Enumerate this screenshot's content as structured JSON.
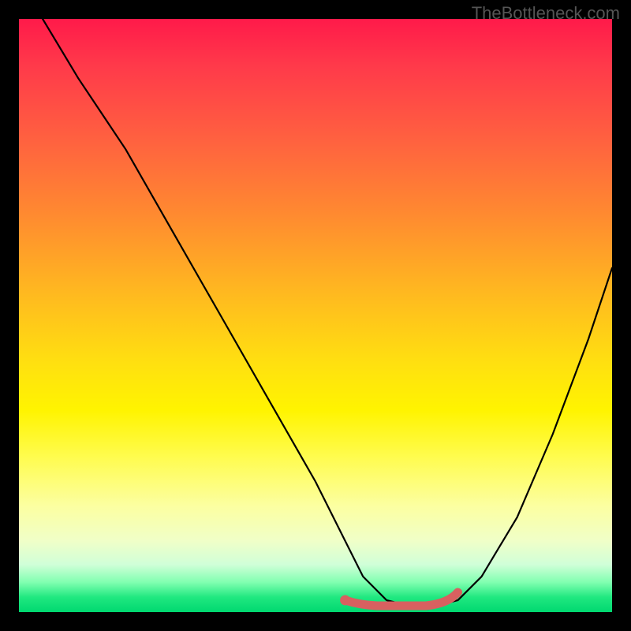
{
  "watermark": "TheBottleneck.com",
  "chart_data": {
    "type": "line",
    "title": "",
    "xlabel": "",
    "ylabel": "",
    "xlim": [
      0,
      100
    ],
    "ylim": [
      0,
      100
    ],
    "series": [
      {
        "name": "bottleneck-curve",
        "x": [
          4,
          10,
          18,
          26,
          34,
          42,
          50,
          55,
          58,
          62,
          66,
          70,
          74,
          78,
          84,
          90,
          96,
          100
        ],
        "y": [
          100,
          90,
          78,
          64,
          50,
          36,
          22,
          12,
          6,
          2,
          1,
          1,
          2,
          6,
          16,
          30,
          46,
          58
        ]
      }
    ],
    "annotations": [
      {
        "name": "flat-bottom-highlight",
        "type": "segment",
        "x": [
          55,
          74
        ],
        "y": [
          2,
          2
        ],
        "color": "#d86060"
      }
    ]
  }
}
